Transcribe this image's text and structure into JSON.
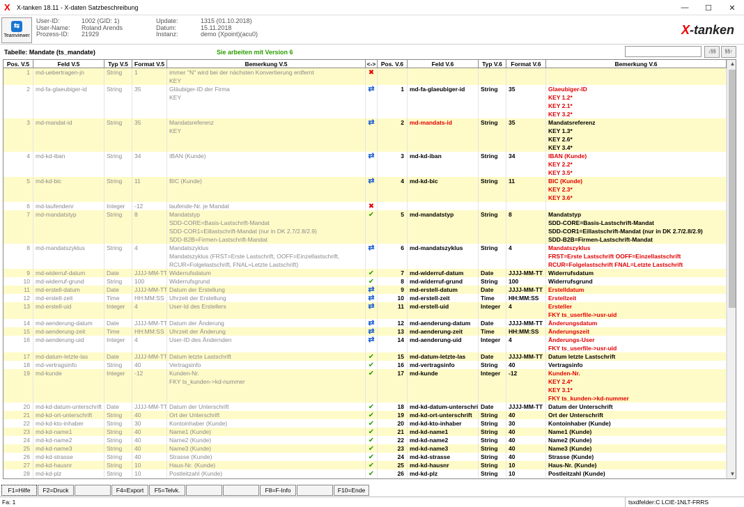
{
  "window": {
    "title": "X-tanken 18.11 - X-daten Satzbeschreibung"
  },
  "teamviewer": {
    "label": "Teamviewer"
  },
  "info": {
    "labels": [
      "User-ID:",
      "User-Name:",
      "Prozess-ID:"
    ],
    "values": [
      "1002 (GID: 1)",
      "Roland Arends",
      "21929"
    ],
    "labels2": [
      "Update:",
      "Datum:",
      "Instanz:"
    ],
    "values2": [
      "1315 (01.10.2018)",
      "15.11.2018",
      "demo (Xpoint)(acu0)"
    ]
  },
  "brand": {
    "x": "X",
    "rest": "-tanken"
  },
  "caption": "Tabelle: Mandate (ts_mandate)",
  "version": "Sie arbeiten mit Version 6",
  "search_btns": [
    "↓§§",
    "§§↑"
  ],
  "columns": [
    "Pos. V.5",
    "Feld V.5",
    "Typ V.5",
    "Format V.5",
    "Bemerkung V.5",
    "<->",
    "Pos. V.6",
    "Feld V.6",
    "Typ V.6",
    "Format V.6",
    "Bemerkung V.6"
  ],
  "rows": [
    {
      "p5": "1",
      "f5": "md-uebertragen-jn",
      "t5": "String",
      "fo5": "1",
      "b5": [
        "immer \"N\" wird bei der nächsten Konvertierung entfernt",
        "KEY"
      ],
      "mk": "x",
      "p6": "",
      "f6": "",
      "t6": "",
      "fo6": "",
      "b6": [],
      "r6": [],
      "fr": false
    },
    {
      "p5": "2",
      "f5": "md-fa-glaeubiger-id",
      "t5": "String",
      "fo5": "35",
      "b5": [
        "Gläubiger-ID der Firma",
        "KEY"
      ],
      "mk": "c",
      "p6": "1",
      "f6": "md-fa-glaeubiger-id",
      "t6": "String",
      "fo6": "35",
      "b6": [
        "Glaeubiger-ID",
        "KEY 1.2*",
        "KEY 2.1*",
        "KEY 3.2*"
      ],
      "r6": [
        1,
        1,
        1,
        1
      ],
      "fr": false
    },
    {
      "p5": "3",
      "f5": "md-mandat-id",
      "t5": "String",
      "fo5": "35",
      "b5": [
        "Mandatsreferenz",
        "KEY"
      ],
      "mk": "c",
      "p6": "2",
      "f6": "md-mandats-id",
      "t6": "String",
      "fo6": "35",
      "b6": [
        "Mandatsreferenz",
        "KEY 1.3*",
        "KEY 2.6*",
        "KEY 3.4*"
      ],
      "r6": [
        0,
        0,
        0,
        0
      ],
      "fr": true
    },
    {
      "p5": "4",
      "f5": "md-kd-iban",
      "t5": "String",
      "fo5": "34",
      "b5": [
        "IBAN (Kunde)"
      ],
      "mk": "c",
      "p6": "3",
      "f6": "md-kd-iban",
      "t6": "String",
      "fo6": "34",
      "b6": [
        "IBAN (Kunde)",
        "KEY 2.2*",
        "KEY 3.5*"
      ],
      "r6": [
        1,
        1,
        1
      ],
      "fr": false
    },
    {
      "p5": "5",
      "f5": "md-kd-bic",
      "t5": "String",
      "fo5": "11",
      "b5": [
        "BIC (Kunde)"
      ],
      "mk": "c",
      "p6": "4",
      "f6": "md-kd-bic",
      "t6": "String",
      "fo6": "11",
      "b6": [
        "BIC (Kunde)",
        "KEY 2.3*",
        "KEY 3.6*"
      ],
      "r6": [
        1,
        1,
        1
      ],
      "fr": false
    },
    {
      "p5": "6",
      "f5": "md-laufendenr",
      "t5": "Integer",
      "fo5": "-12",
      "b5": [
        "laufende-Nr. je Mandat"
      ],
      "mk": "x",
      "p6": "",
      "f6": "",
      "t6": "",
      "fo6": "",
      "b6": [],
      "r6": [],
      "fr": false
    },
    {
      "p5": "7",
      "f5": "md-mandatstyp",
      "t5": "String",
      "fo5": "8",
      "b5": [
        "Mandatstyp",
        "SDD-CORE=Basis-Lastschrift-Mandat",
        "SDD-COR1=Eillastschrift-Mandat (nur in DK 2.7/2.8/2.9)",
        "SDD-B2B=Firmen-Lastschrift-Mandat"
      ],
      "mk": "v",
      "p6": "5",
      "f6": "md-mandatstyp",
      "t6": "String",
      "fo6": "8",
      "b6": [
        "Mandatstyp",
        "SDD-CORE=Basis-Lastschrift-Mandat",
        "SDD-COR1=Eillastschrift-Mandat (nur in DK 2.7/2.8/2.9)",
        "SDD-B2B=Firmen-Lastschrift-Mandat"
      ],
      "r6": [
        0,
        0,
        0,
        0
      ],
      "fr": false
    },
    {
      "p5": "8",
      "f5": "md-mandatszyklus",
      "t5": "String",
      "fo5": "4",
      "b5": [
        "Mandatszyklus",
        "Mandatszyklus (FRST=Erste Lastschrift, OOFF=Einzellastschrift,",
        "RCUR=Folgelastschrift, FNAL=Letzte Lastschrift)"
      ],
      "mk": "c",
      "p6": "6",
      "f6": "md-mandatszyklus",
      "t6": "String",
      "fo6": "4",
      "b6": [
        "Mandatszyklus",
        "FRST=Erste Lastschrift OOFF=Einzellastschrift",
        "RCUR=Folgelastschrift FNAL=Letzte Lastschrift"
      ],
      "r6": [
        1,
        1,
        1
      ],
      "fr": false
    },
    {
      "p5": "9",
      "f5": "md-widerruf-datum",
      "t5": "Date",
      "fo5": "JJJJ-MM-TT",
      "b5": [
        "Widerrufsdatum"
      ],
      "mk": "v",
      "p6": "7",
      "f6": "md-widerruf-datum",
      "t6": "Date",
      "fo6": "JJJJ-MM-TT",
      "b6": [
        "Widerrufsdatum"
      ],
      "r6": [
        0
      ],
      "fr": false
    },
    {
      "p5": "10",
      "f5": "md-widerruf-grund",
      "t5": "String",
      "fo5": "100",
      "b5": [
        "Widerrufsgrund"
      ],
      "mk": "v",
      "p6": "8",
      "f6": "md-widerruf-grund",
      "t6": "String",
      "fo6": "100",
      "b6": [
        "Widerrufsgrund"
      ],
      "r6": [
        0
      ],
      "fr": false
    },
    {
      "p5": "11",
      "f5": "md-erstell-datum",
      "t5": "Date",
      "fo5": "JJJJ-MM-TT",
      "b5": [
        "Datum der Erstellung"
      ],
      "mk": "c",
      "p6": "9",
      "f6": "md-erstell-datum",
      "t6": "Date",
      "fo6": "JJJJ-MM-TT",
      "b6": [
        "Erstelldatum"
      ],
      "r6": [
        1
      ],
      "fr": false
    },
    {
      "p5": "12",
      "f5": "md-erstell-zeit",
      "t5": "Time",
      "fo5": "HH:MM:SS",
      "b5": [
        "Uhrzeit der Erstellung"
      ],
      "mk": "c",
      "p6": "10",
      "f6": "md-erstell-zeit",
      "t6": "Time",
      "fo6": "HH:MM:SS",
      "b6": [
        "Erstellzeit"
      ],
      "r6": [
        1
      ],
      "fr": false
    },
    {
      "p5": "13",
      "f5": "md-erstell-uid",
      "t5": "Integer",
      "fo5": "4",
      "b5": [
        "User-Id des Erstellers"
      ],
      "mk": "c",
      "p6": "11",
      "f6": "md-erstell-uid",
      "t6": "Integer",
      "fo6": "4",
      "b6": [
        "Ersteller",
        "FKY ts_userfile->usr-uid"
      ],
      "r6": [
        1,
        1
      ],
      "fr": false
    },
    {
      "p5": "14",
      "f5": "md-aenderung-datum",
      "t5": "Date",
      "fo5": "JJJJ-MM-TT",
      "b5": [
        "Datum der Änderung"
      ],
      "mk": "c",
      "p6": "12",
      "f6": "md-aenderung-datum",
      "t6": "Date",
      "fo6": "JJJJ-MM-TT",
      "b6": [
        "Änderungsdatum"
      ],
      "r6": [
        1
      ],
      "fr": false
    },
    {
      "p5": "15",
      "f5": "md-aenderung-zeit",
      "t5": "Time",
      "fo5": "HH:MM:SS",
      "b5": [
        "Uhrzeit der Änderung"
      ],
      "mk": "c",
      "p6": "13",
      "f6": "md-aenderung-zeit",
      "t6": "Time",
      "fo6": "HH:MM:SS",
      "b6": [
        "Änderungszeit"
      ],
      "r6": [
        1
      ],
      "fr": false
    },
    {
      "p5": "16",
      "f5": "md-aenderung-uid",
      "t5": "Integer",
      "fo5": "4",
      "b5": [
        "User-ID des Ändernden"
      ],
      "mk": "c",
      "p6": "14",
      "f6": "md-aenderung-uid",
      "t6": "Integer",
      "fo6": "4",
      "b6": [
        "Änderungs-User",
        "FKY ts_userfile->usr-uid"
      ],
      "r6": [
        1,
        1
      ],
      "fr": false
    },
    {
      "p5": "17",
      "f5": "md-datum-letzte-las",
      "t5": "Date",
      "fo5": "JJJJ-MM-TT",
      "b5": [
        "Datum letzte Lastschrift"
      ],
      "mk": "v",
      "p6": "15",
      "f6": "md-datum-letzte-las",
      "t6": "Date",
      "fo6": "JJJJ-MM-TT",
      "b6": [
        "Datum letzte Lastschrift"
      ],
      "r6": [
        0
      ],
      "fr": false
    },
    {
      "p5": "18",
      "f5": "md-vertragsinfo",
      "t5": "String",
      "fo5": "40",
      "b5": [
        "Vertragsinfo"
      ],
      "mk": "v",
      "p6": "16",
      "f6": "md-vertragsinfo",
      "t6": "String",
      "fo6": "40",
      "b6": [
        "Vertragsinfo"
      ],
      "r6": [
        0
      ],
      "fr": false
    },
    {
      "p5": "19",
      "f5": "md-kunde",
      "t5": "Integer",
      "fo5": "-12",
      "b5": [
        "Kunden-Nr.",
        "FKY ts_kunden->kd-nummer"
      ],
      "mk": "v",
      "p6": "17",
      "f6": "md-kunde",
      "t6": "Integer",
      "fo6": "-12",
      "b6": [
        "Kunden-Nr.",
        "KEY 2.4*",
        "KEY 3.1*",
        "FKY ts_kunden->kd-nummer"
      ],
      "r6": [
        1,
        1,
        1,
        1
      ],
      "fr": false
    },
    {
      "p5": "20",
      "f5": "md-kd-datum-unterschrift",
      "t5": "Date",
      "fo5": "JJJJ-MM-TT",
      "b5": [
        "Datum der Unterschrift"
      ],
      "mk": "v",
      "p6": "18",
      "f6": "md-kd-datum-unterschrift",
      "t6": "Date",
      "fo6": "JJJJ-MM-TT",
      "b6": [
        "Datum der Unterschrift"
      ],
      "r6": [
        0
      ],
      "fr": false
    },
    {
      "p5": "21",
      "f5": "md-kd-ort-unterschrift",
      "t5": "String",
      "fo5": "40",
      "b5": [
        "Ort der Unterschrift"
      ],
      "mk": "v",
      "p6": "19",
      "f6": "md-kd-ort-unterschrift",
      "t6": "String",
      "fo6": "40",
      "b6": [
        "Ort der Unterschrift"
      ],
      "r6": [
        0
      ],
      "fr": false
    },
    {
      "p5": "22",
      "f5": "md-kd-kto-inhaber",
      "t5": "String",
      "fo5": "30",
      "b5": [
        "Kontoinhaber (Kunde)"
      ],
      "mk": "v",
      "p6": "20",
      "f6": "md-kd-kto-inhaber",
      "t6": "String",
      "fo6": "30",
      "b6": [
        "Kontoinhaber (Kunde)"
      ],
      "r6": [
        0
      ],
      "fr": false
    },
    {
      "p5": "23",
      "f5": "md-kd-name1",
      "t5": "String",
      "fo5": "40",
      "b5": [
        "Name1 (Kunde)"
      ],
      "mk": "v",
      "p6": "21",
      "f6": "md-kd-name1",
      "t6": "String",
      "fo6": "40",
      "b6": [
        "Name1 (Kunde)"
      ],
      "r6": [
        0
      ],
      "fr": false
    },
    {
      "p5": "24",
      "f5": "md-kd-name2",
      "t5": "String",
      "fo5": "40",
      "b5": [
        "Name2 (Kunde)"
      ],
      "mk": "v",
      "p6": "22",
      "f6": "md-kd-name2",
      "t6": "String",
      "fo6": "40",
      "b6": [
        "Name2 (Kunde)"
      ],
      "r6": [
        0
      ],
      "fr": false
    },
    {
      "p5": "25",
      "f5": "md-kd-name3",
      "t5": "String",
      "fo5": "40",
      "b5": [
        "Name3 (Kunde)"
      ],
      "mk": "v",
      "p6": "23",
      "f6": "md-kd-name3",
      "t6": "String",
      "fo6": "40",
      "b6": [
        "Name3 (Kunde)"
      ],
      "r6": [
        0
      ],
      "fr": false
    },
    {
      "p5": "26",
      "f5": "md-kd-strasse",
      "t5": "String",
      "fo5": "40",
      "b5": [
        "Strasse (Kunde)"
      ],
      "mk": "v",
      "p6": "24",
      "f6": "md-kd-strasse",
      "t6": "String",
      "fo6": "40",
      "b6": [
        "Strasse (Kunde)"
      ],
      "r6": [
        0
      ],
      "fr": false
    },
    {
      "p5": "27",
      "f5": "md-kd-hausnr",
      "t5": "String",
      "fo5": "10",
      "b5": [
        "Haus-Nr. (Kunde)"
      ],
      "mk": "v",
      "p6": "25",
      "f6": "md-kd-hausnr",
      "t6": "String",
      "fo6": "10",
      "b6": [
        "Haus-Nr. (Kunde)"
      ],
      "r6": [
        0
      ],
      "fr": false
    },
    {
      "p5": "28",
      "f5": "md-kd-plz",
      "t5": "String",
      "fo5": "10",
      "b5": [
        "Postleitzahl (Kunde)"
      ],
      "mk": "v",
      "p6": "26",
      "f6": "md-kd-plz",
      "t6": "String",
      "fo6": "10",
      "b6": [
        "Postleitzahl (Kunde)"
      ],
      "r6": [
        0
      ],
      "fr": false
    }
  ],
  "fkeys": [
    "F1=Hilfe",
    "F2=Druck",
    "",
    "F4=Export",
    "F5=Telvk.",
    "",
    "",
    "F8=F-Info",
    "",
    "F10=Ende"
  ],
  "status": {
    "left": "Fa: 1",
    "right": "tsxdfelder:C LCIE-1NLT-FRRS"
  },
  "colors": {
    "row_yellow": "#fffbc8",
    "row_white": "#ffffff",
    "red": "#e00000",
    "green": "#2a9d00",
    "blue": "#1f5fd1"
  }
}
